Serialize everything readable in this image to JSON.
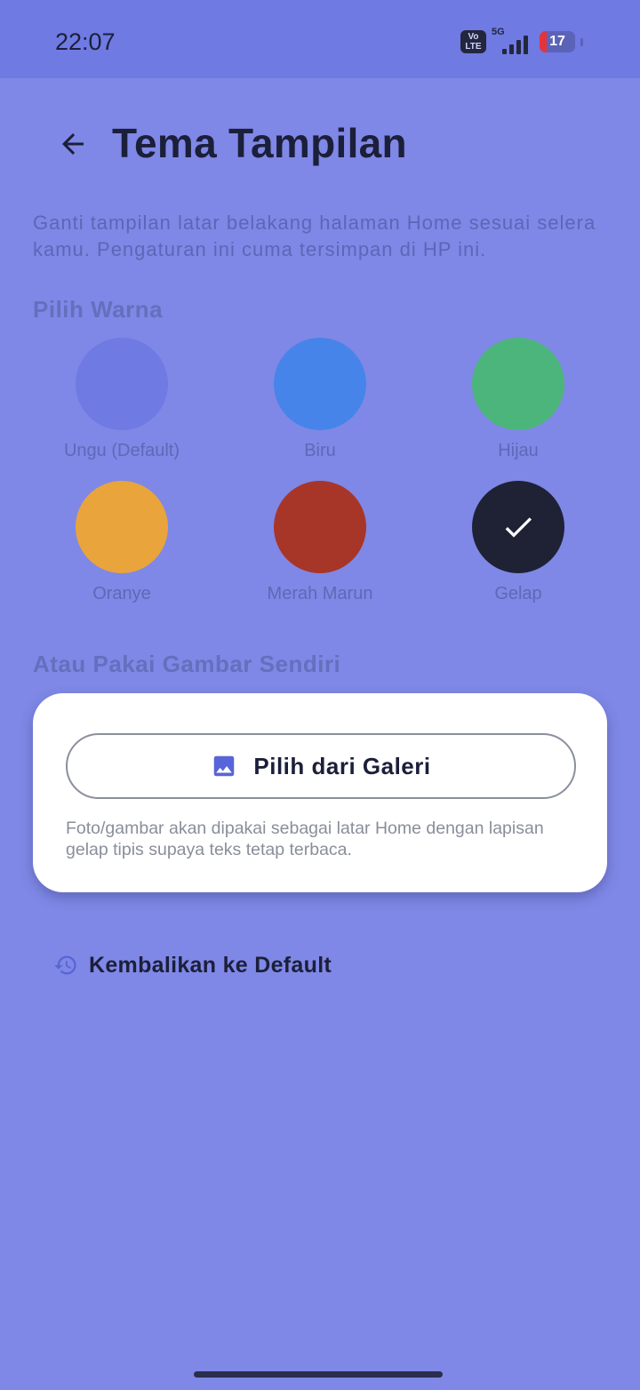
{
  "status_bar": {
    "time": "22:07",
    "volte_top": "Vo",
    "volte_bottom": "LTE",
    "network": "5G",
    "battery": "17"
  },
  "header": {
    "back_icon": "arrow-left-icon",
    "title": "Tema Tampilan"
  },
  "description": "Ganti tampilan latar belakang halaman Home sesuai selera kamu. Pengaturan ini cuma tersimpan di HP ini.",
  "colors_section": {
    "label": "Pilih Warna",
    "options": [
      {
        "label": "Ungu (Default)",
        "color": "#6f7ae3",
        "selected": false
      },
      {
        "label": "Biru",
        "color": "#4784ea",
        "selected": false
      },
      {
        "label": "Hijau",
        "color": "#4bb57b",
        "selected": false
      },
      {
        "label": "Oranye",
        "color": "#eaa43c",
        "selected": false
      },
      {
        "label": "Merah Marun",
        "color": "#a83628",
        "selected": false
      },
      {
        "label": "Gelap",
        "color": "#1f2235",
        "selected": true
      }
    ],
    "check_icon": "checkmark-icon"
  },
  "image_section": {
    "label": "Atau Pakai Gambar Sendiri",
    "gallery_button": "Pilih dari Galeri",
    "gallery_icon": "image-icon",
    "note": "Foto/gambar akan dipakai sebagai latar Home dengan lapisan gelap tipis supaya teks tetap terbaca."
  },
  "reset": {
    "label": "Kembalikan ke Default",
    "icon": "history-icon"
  },
  "theme": {
    "background": "#7f88e6",
    "status_bar_bg": "#6f7ae3",
    "text_dark": "#1c1f3a",
    "accent": "#5865d8"
  }
}
